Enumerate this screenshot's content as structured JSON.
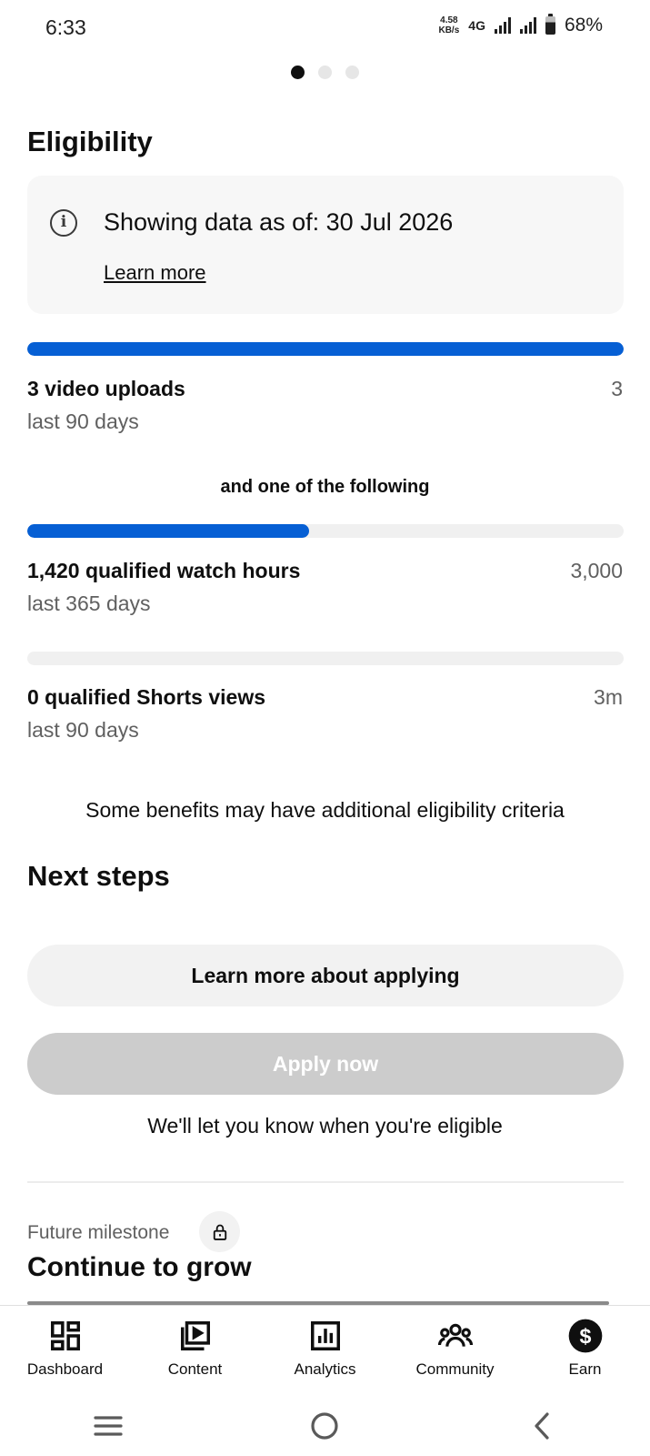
{
  "status_bar": {
    "time": "6:33",
    "net_speed_value": "4.58",
    "net_speed_unit": "KB/s",
    "network_type": "4G",
    "battery": "68%",
    "battery_level": 0.68
  },
  "pager": {
    "count": 3,
    "active": 0
  },
  "eligibility": {
    "title": "Eligibility",
    "info_text": "Showing data as of: 30 Jul 2026",
    "learn_more": "Learn more",
    "uploads": {
      "label": "3 video uploads",
      "target": "3",
      "period": "last 90 days",
      "progress": 1.0
    },
    "one_of_following": "and one of the following",
    "watch_hours": {
      "label": "1,420 qualified watch hours",
      "target": "3,000",
      "period": "last 365 days",
      "progress": 0.4733
    },
    "shorts_views": {
      "label": "0 qualified Shorts views",
      "target": "3m",
      "period": "last 90 days",
      "progress": 0
    },
    "additional_note": "Some benefits may have additional eligibility criteria"
  },
  "next_steps": {
    "title": "Next steps",
    "learn_button": "Learn more about applying",
    "apply_button": "Apply now",
    "notify_text": "We'll let you know when you're eligible"
  },
  "milestone": {
    "label": "Future milestone",
    "title": "Continue to grow"
  },
  "bottom_nav": {
    "items": [
      {
        "label": "Dashboard",
        "icon": "dashboard-icon"
      },
      {
        "label": "Content",
        "icon": "content-icon"
      },
      {
        "label": "Analytics",
        "icon": "analytics-icon"
      },
      {
        "label": "Community",
        "icon": "community-icon"
      },
      {
        "label": "Earn",
        "icon": "earn-icon"
      }
    ],
    "active_index": 4
  },
  "system_nav": {
    "icons": [
      "recents-icon",
      "home-icon",
      "back-icon"
    ]
  },
  "colors": {
    "progress_fill": "#065fd4",
    "progress_track": "#f0f0f0",
    "disabled_button": "#cccccc",
    "secondary_button": "#f2f2f2"
  }
}
